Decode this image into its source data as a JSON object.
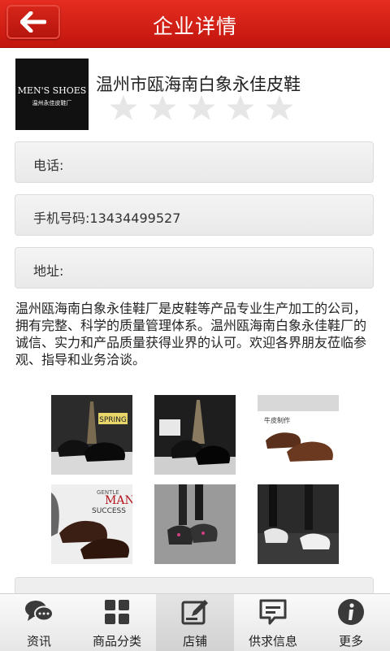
{
  "header": {
    "title": "企业详情"
  },
  "company": {
    "logo_text_en": "MEN'S SHOES",
    "logo_text_cn": "温州永佳皮鞋厂",
    "name": "温州市瓯海南白象永佳皮鞋",
    "rating": 0,
    "rating_max": 5
  },
  "fields": {
    "phone_label": "电话:",
    "mobile_label": "手机号码:13434499527",
    "address_label": "地址:"
  },
  "description": "温州瓯海南白象永佳鞋厂是皮鞋等产品专业生产加工的公司，拥有完整、科学的质量管理体系。温州瓯海南白象永佳鞋厂的诚信、实力和产品质量获得业界的认可。欢迎各界朋友莅临参观、指导和业务洽谈。",
  "gallery": {
    "img1_text": "SPRING",
    "img3_text": "牛皮制作",
    "img4_text1": "GENTLE",
    "img4_text2": "MAN",
    "img4_text3": "SUCCESS"
  },
  "tabs": [
    {
      "label": "资讯",
      "icon": "chat-bubbles-icon"
    },
    {
      "label": "商品分类",
      "icon": "grid-icon"
    },
    {
      "label": "店铺",
      "icon": "edit-store-icon"
    },
    {
      "label": "供求信息",
      "icon": "message-box-icon"
    },
    {
      "label": "更多",
      "icon": "info-icon"
    }
  ],
  "colors": {
    "header": "#d4201a",
    "accent": "#c2150e"
  }
}
